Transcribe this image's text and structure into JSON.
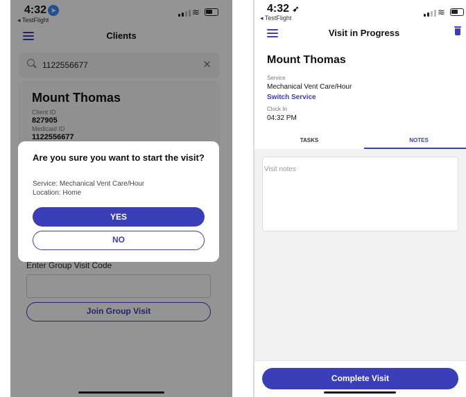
{
  "left": {
    "status": {
      "time": "4:32",
      "back_app": "◂ TestFlight"
    },
    "header": {
      "title": "Clients"
    },
    "search": {
      "value": "1122556677"
    },
    "client": {
      "name": "Mount Thomas",
      "client_id_label": "Client ID",
      "client_id": "827905",
      "medicaid_id_label": "Medicaid ID",
      "medicaid_id": "1122556677"
    },
    "group": {
      "label": "Enter Group Visit Code",
      "input_value": "",
      "join_label": "Join Group Visit"
    },
    "modal": {
      "title": "Are you sure you want to start the visit?",
      "service_line": "Service: Mechanical Vent Care/Hour",
      "location_line": "Location: Home",
      "yes_label": "YES",
      "no_label": "NO"
    }
  },
  "right": {
    "status": {
      "time": "4:32",
      "back_app": "◂ TestFlight"
    },
    "header": {
      "title": "Visit in Progress"
    },
    "client_name": "Mount Thomas",
    "service_label": "Service",
    "service_value": "Mechanical Vent Care/Hour",
    "switch_service": "Switch Service",
    "clock_in_label": "Clock In",
    "clock_in_value": "04:32 PM",
    "tabs": [
      {
        "label": "TASKS",
        "active": false
      },
      {
        "label": "NOTES",
        "active": true
      }
    ],
    "notes_placeholder": "Visit notes",
    "complete_label": "Complete Visit"
  },
  "colors": {
    "accent": "#3a3eb8",
    "overlay": "rgba(0,0,0,0.42)"
  }
}
